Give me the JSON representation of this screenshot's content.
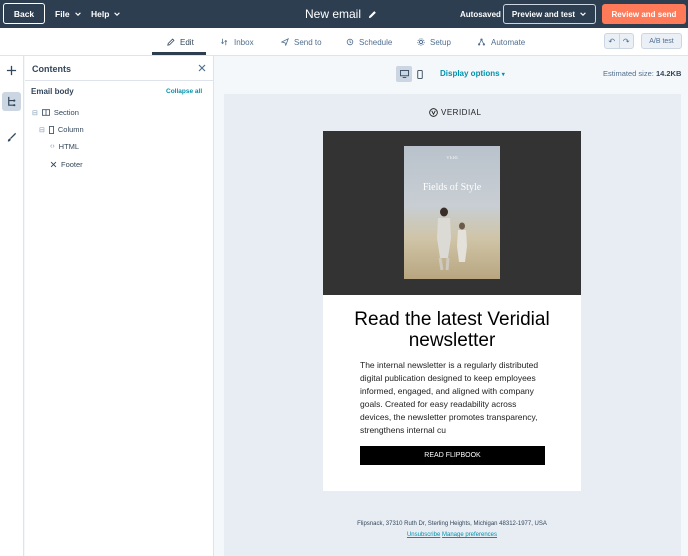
{
  "topbar": {
    "back_label": "Back",
    "file_label": "File",
    "help_label": "Help",
    "title": "New email",
    "autosaved": "Autosaved",
    "preview_label": "Preview and test",
    "review_label": "Review and send"
  },
  "tabs": [
    {
      "label": "Edit",
      "icon": "pencil-icon",
      "active": true
    },
    {
      "label": "Inbox",
      "icon": "inbox-icon",
      "active": false
    },
    {
      "label": "Send to",
      "icon": "send-icon",
      "active": false
    },
    {
      "label": "Schedule",
      "icon": "schedule-icon",
      "active": false
    },
    {
      "label": "Setup",
      "icon": "gear-icon",
      "active": false
    },
    {
      "label": "Automate",
      "icon": "automate-icon",
      "active": false
    }
  ],
  "toolbar": {
    "undo_glyph": "↶",
    "redo_glyph": "↷",
    "ab_test_label": "A/B test"
  },
  "panel": {
    "title": "Contents",
    "email_body_label": "Email body",
    "collapse_label": "Collapse all",
    "tree": [
      "Section",
      "Column",
      "HTML",
      "Footer"
    ]
  },
  "canvas": {
    "display_options": "Display options",
    "est_size_label": "Estimated size:",
    "est_size_value": "14.2KB"
  },
  "email": {
    "brand": "VERIDIAL",
    "cover_top": "VERI",
    "cover_title": "Fields of Style",
    "headline": "Read the latest Veridial newsletter",
    "body": "The internal newsletter is a regularly distributed digital publication designed to keep employees informed, engaged, and aligned with company goals. Created for easy readability across devices, the newsletter promotes transparency, strengthens internal cu",
    "cta": "READ FLIPBOOK",
    "address": "Flipsnack, 37310 Ruth Dr, Sterling Heights, Michigan 48312-1977, USA",
    "unsubscribe": "Unsubscribe",
    "manage": "Manage preferences"
  },
  "colors": {
    "topbar": "#2d3e50",
    "accent": "#ff7a59",
    "link": "#0091ae"
  }
}
